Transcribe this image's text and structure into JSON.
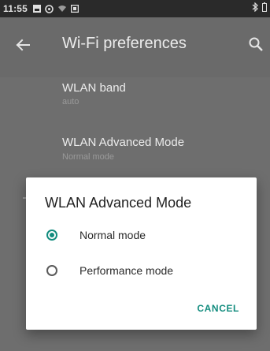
{
  "status_bar": {
    "time": "11:55"
  },
  "app_bar": {
    "title": "Wi-Fi preferences"
  },
  "preferences": [
    {
      "title": "WLAN band",
      "summary": "auto"
    },
    {
      "title": "WLAN Advanced Mode",
      "summary": "Normal mode"
    }
  ],
  "dialog": {
    "title": "WLAN Advanced Mode",
    "options": [
      {
        "label": "Normal mode",
        "selected": true
      },
      {
        "label": "Performance mode",
        "selected": false
      }
    ],
    "cancel_label": "CANCEL"
  },
  "colors": {
    "accent": "#128c7e",
    "dim_background": "#6e6e6e",
    "status_bar": "#2a2a2a"
  },
  "icons": [
    "bluetooth-icon",
    "back-arrow-icon",
    "search-icon",
    "notification-icons"
  ]
}
